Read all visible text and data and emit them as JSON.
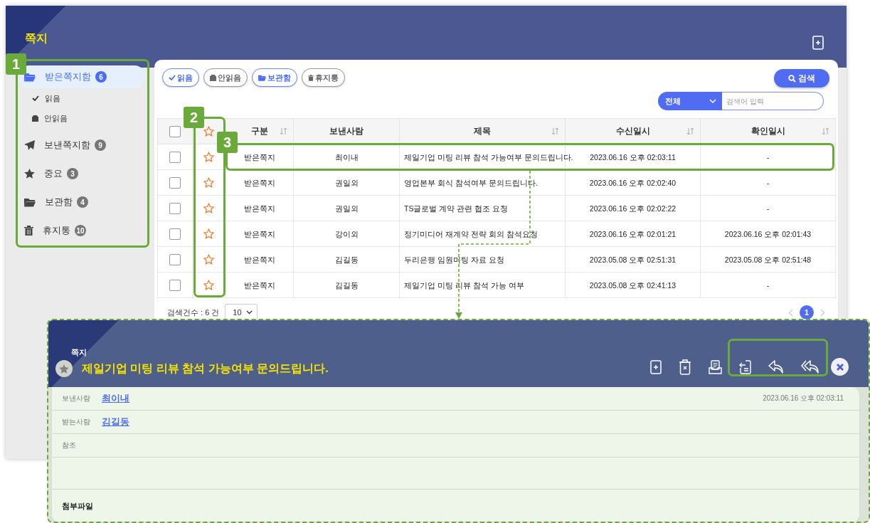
{
  "app": {
    "title": "쪽지"
  },
  "sidebar": {
    "items": [
      {
        "label": "받은쪽지함",
        "count": "6",
        "selected": true,
        "children": [
          {
            "label": "읽음"
          },
          {
            "label": "안읽음"
          }
        ]
      },
      {
        "label": "보낸쪽지함",
        "count": "9",
        "selected": false
      },
      {
        "label": "중요",
        "count": "3",
        "selected": false
      },
      {
        "label": "보관함",
        "count": "4",
        "selected": false
      },
      {
        "label": "휴지통",
        "count": "10",
        "selected": false
      }
    ]
  },
  "filter_buttons": [
    {
      "label": "읽음",
      "selected": true
    },
    {
      "label": "안읽음",
      "selected": false
    },
    {
      "label": "보관함",
      "selected": true
    },
    {
      "label": "휴지통",
      "selected": false
    }
  ],
  "search": {
    "button": "검색",
    "scope": "전체",
    "placeholder": "검색어 입력"
  },
  "table": {
    "columns": [
      {
        "label": "구분",
        "sortable": true
      },
      {
        "label": "보낸사람",
        "sortable": false
      },
      {
        "label": "제목",
        "sortable": true
      },
      {
        "label": "수신일시",
        "sortable": true
      },
      {
        "label": "확인일시",
        "sortable": true
      }
    ],
    "header_checked": false,
    "header_starred": false,
    "rows": [
      {
        "checked": false,
        "starred": false,
        "cells": [
          "받은쪽지",
          "최이내",
          "제일기업 미팅 리뷰 참석 가능여부 문의드립니다.",
          "2023.06.16 오후 02:03:11",
          "-"
        ]
      },
      {
        "checked": false,
        "starred": false,
        "cells": [
          "받은쪽지",
          "권일외",
          "영업본부 회식 참석여부 문의드립니다.",
          "2023.06.16 오후 02:02:40",
          "-"
        ]
      },
      {
        "checked": false,
        "starred": false,
        "cells": [
          "받은쪽지",
          "권일외",
          "TS글로벌 계약 관련 협조 요청",
          "2023.06.16 오후 02:02:22",
          "-"
        ]
      },
      {
        "checked": false,
        "starred": false,
        "cells": [
          "받은쪽지",
          "강이외",
          "정기미디어 재계약 전략 회의 참석요청",
          "2023.06.16 오후 02:01:21",
          "2023.06.16 오후 02:01:43"
        ]
      },
      {
        "checked": false,
        "starred": false,
        "cells": [
          "받은쪽지",
          "김길동",
          "두리은행 임원미팅 자료 요청",
          "2023.05.08 오후 02:51:31",
          "2023.05.08 오후 02:51:48"
        ]
      },
      {
        "checked": false,
        "starred": false,
        "cells": [
          "받은쪽지",
          "김길동",
          "제일기업 미팅 리뷰 참석 가능 여부",
          "2023.05.08 오후 02:41:13",
          "-"
        ]
      }
    ]
  },
  "footer": {
    "count": "검색건수 : 6 건",
    "page_size": "10",
    "pages": [
      {
        "label": "1",
        "selected": true
      }
    ]
  },
  "message": {
    "window_label": "쪽지",
    "starred": false,
    "title": "제일기업 미팅 리뷰 참석 가능여부 문의드립니다.",
    "fields": [
      {
        "label": "보낸사람",
        "value": "최이내",
        "date": "2023.06.16 오후 02:03:11"
      },
      {
        "label": "받는사람",
        "value": "김길동"
      },
      {
        "label": "참조"
      }
    ],
    "attachments_label": "첨부파일"
  },
  "callouts": [
    {
      "label": "1"
    },
    {
      "label": "2"
    },
    {
      "label": "3"
    }
  ]
}
